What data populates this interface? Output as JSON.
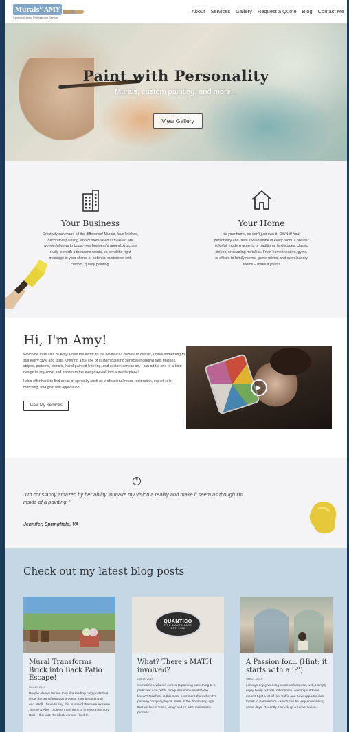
{
  "header": {
    "logo": {
      "line1": "Murals",
      "by": "by",
      "name": "AMY",
      "tagline": "Custom Artistry, Professional Service"
    },
    "nav": [
      "About",
      "Services",
      "Gallery",
      "Request a Quote",
      "Blog",
      "Contact Me"
    ]
  },
  "hero": {
    "title": "Paint with Personality",
    "subtitle": "Murals, custom painting, and more...",
    "button": "View Gallery"
  },
  "services": [
    {
      "icon": "building-icon",
      "title": "Your Business",
      "text": "Creativity can make all the difference! Murals, faux finishes, decorative painting, and custom-sized canvas art are wonderful ways to boost your business's appeal. A picture really is worth a thousand words, so send the right message to your clients or potential customers with custom, quality painting."
    },
    {
      "icon": "house-icon",
      "title": "Your Home",
      "text": "It's your home, so don't just own it- OWN it! Your personality and taste should shine in every room. Consider colorful, modern accents or traditional landscapes, classic stripes, or dazzling metallics. From home theaters, gyms, or offices to family rooms, game rooms, and even laundry rooms – make it yours!"
    }
  ],
  "about": {
    "title": "Hi, I'm Amy!",
    "p1": "Welcome to Murals by Amy! From the exotic to the whimsical, colorful to classic, I have something to suit every style and taste. Offering a full line of custom painting services including faux finishes, stripes, patterns, stencils, hand-painted lettering, and custom canvas art, I can add a one-of-a-kind design to any room and transform the everyday wall into a masterpiece!",
    "p2": "I also offer hard-to-find areas of specialty such as professional mural restoration, expert color matching, and gold leaf application.",
    "button": "View My Services"
  },
  "testimonial": {
    "quote": "\"I'm constantly amazed by her ability to make my vision a reality and make it seem as though I'm inside of a painting. \"",
    "author": "Jennifer, Springfield, VA"
  },
  "blog": {
    "heading": "Check out my latest blog posts",
    "posts": [
      {
        "title": "Mural Transforms Brick into Back Patio Escape!",
        "date": "Nov 14, 2019",
        "excerpt": "People always tell me they like reading blog posts that show the transformation process from beginning to end. Well, I have to say, this is one of the more extreme 'Before & After' projects I can think of in recent memory. Well....this was the blank canvas I had to..."
      },
      {
        "title": "What? There's MATH involved?",
        "date": "Oct 14, 2019",
        "excerpt": "Sometimes, when it comes to painting something to a particular size, YES, it requires some math! Who knew?! Nowhere is this more prominent than when I'm painting company logos. Sure, in the Photoshop age that we live in 'click', 'drag' and 're-size' makes this process...",
        "image_text": {
          "brand": "QUANTICO",
          "sub": "TIRE & AUTO CARE",
          "est": "EST. 1996"
        }
      },
      {
        "title": "A Passion for... (Hint: it starts with a 'P')",
        "date": "Sep 21, 2019",
        "excerpt": "I always enjoy working outdoors because, well, I simply enjoy being outside. Oftentimes, working outdoors means I get a lot of foot traffic and have opportunities to talk to passersby's - which can be very entertaining some days. Recently, I struck up a conversation..."
      }
    ]
  },
  "colors": {
    "page_bg": "#1b3a5c",
    "services_bg": "#f4f4f6",
    "blog_bg": "#c5d6e5",
    "logo_blue": "#7fa6c9"
  }
}
